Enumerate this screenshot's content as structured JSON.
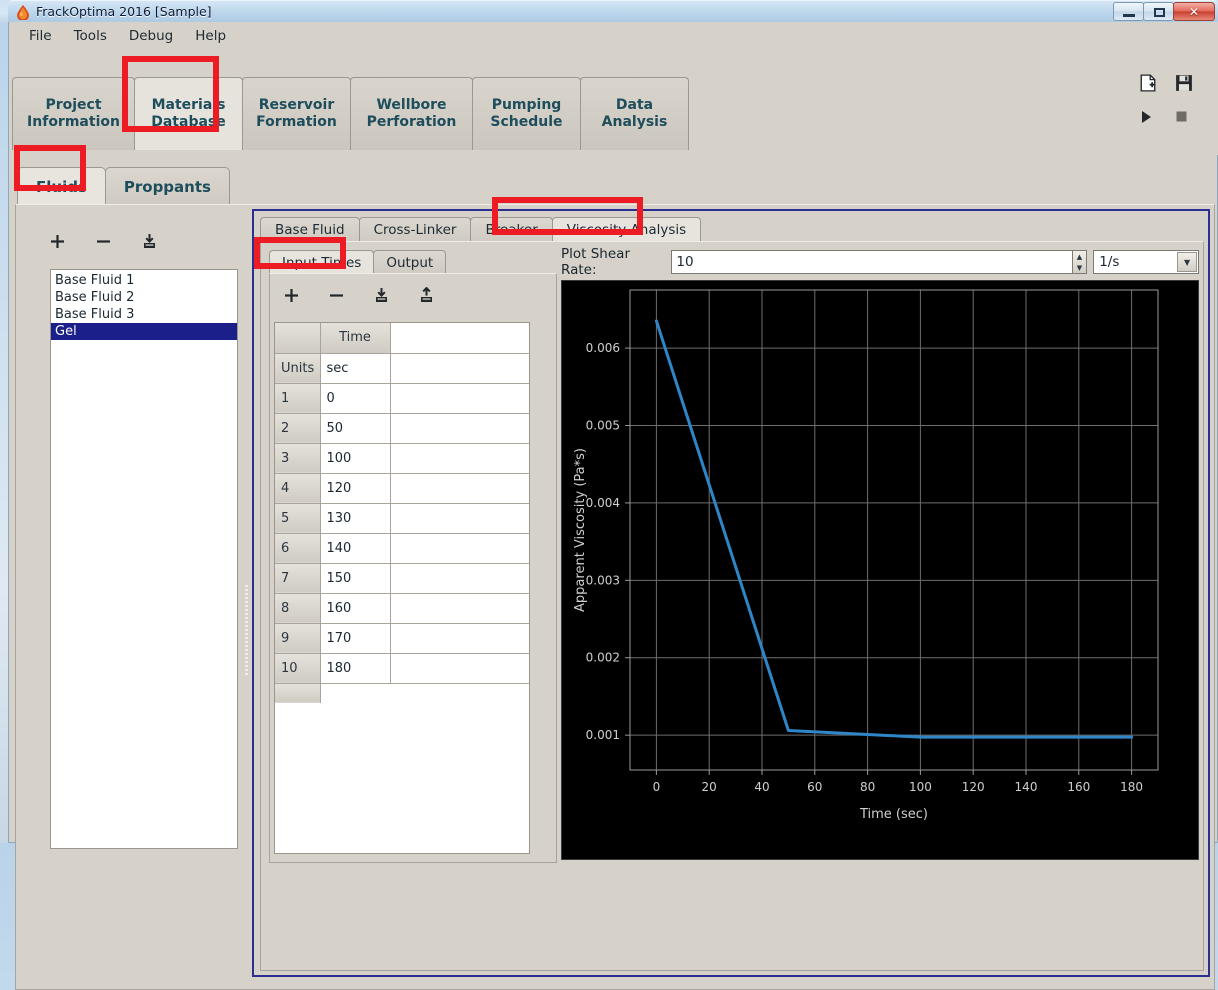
{
  "window": {
    "title": "FrackOptima 2016 [Sample]",
    "app_icon": "oil-drop-icon",
    "minimize": "–",
    "maximize": "□",
    "close": "✕"
  },
  "menu": {
    "items": [
      {
        "label": "File"
      },
      {
        "label": "Tools"
      },
      {
        "label": "Debug"
      },
      {
        "label": "Help"
      }
    ]
  },
  "ribbon": {
    "tabs": [
      {
        "line1": "Project",
        "line2": "Information",
        "active": false
      },
      {
        "line1": "Materials",
        "line2": "Database",
        "active": true
      },
      {
        "line1": "Reservoir",
        "line2": "Formation",
        "active": false
      },
      {
        "line1": "Wellbore",
        "line2": "Perforation",
        "active": false
      },
      {
        "line1": "Pumping",
        "line2": "Schedule",
        "active": false
      },
      {
        "line1": "Data",
        "line2": "Analysis",
        "active": false
      }
    ],
    "icons": [
      {
        "name": "new-file-icon"
      },
      {
        "name": "save-icon"
      },
      {
        "name": "run-icon"
      },
      {
        "name": "stop-icon"
      }
    ]
  },
  "material_tabs": [
    {
      "label": "Fluids",
      "active": true
    },
    {
      "label": "Proppants",
      "active": false
    }
  ],
  "fluid_panel": {
    "tools": [
      {
        "name": "add-fluid-button",
        "glyph": "plus"
      },
      {
        "name": "remove-fluid-button",
        "glyph": "minus"
      },
      {
        "name": "import-fluid-button",
        "glyph": "import"
      }
    ],
    "items": [
      {
        "label": "Base Fluid 1",
        "selected": false
      },
      {
        "label": "Base Fluid 2",
        "selected": false
      },
      {
        "label": "Base Fluid 3",
        "selected": false
      },
      {
        "label": "Gel",
        "selected": true
      }
    ]
  },
  "inner_tabs": [
    {
      "label": "Base Fluid",
      "active": false
    },
    {
      "label": "Cross-Linker",
      "active": false
    },
    {
      "label": "Breaker",
      "active": false
    },
    {
      "label": "Viscosity Analysis",
      "active": true
    }
  ],
  "sub_tabs": [
    {
      "label": "Input Times",
      "active": true
    },
    {
      "label": "Output",
      "active": false
    }
  ],
  "table_tools": [
    {
      "name": "add-row-button",
      "glyph": "plus"
    },
    {
      "name": "remove-row-button",
      "glyph": "minus"
    },
    {
      "name": "import-table-button",
      "glyph": "import"
    },
    {
      "name": "export-table-button",
      "glyph": "export"
    }
  ],
  "input_table": {
    "corner_header": "",
    "columns": [
      "Time"
    ],
    "units_row_label": "Units",
    "units": [
      "sec"
    ],
    "rows": [
      {
        "index": "1",
        "values": [
          "0"
        ]
      },
      {
        "index": "2",
        "values": [
          "50"
        ]
      },
      {
        "index": "3",
        "values": [
          "100"
        ]
      },
      {
        "index": "4",
        "values": [
          "120"
        ]
      },
      {
        "index": "5",
        "values": [
          "130"
        ]
      },
      {
        "index": "6",
        "values": [
          "140"
        ]
      },
      {
        "index": "7",
        "values": [
          "150"
        ]
      },
      {
        "index": "8",
        "values": [
          "160"
        ]
      },
      {
        "index": "9",
        "values": [
          "170"
        ]
      },
      {
        "index": "10",
        "values": [
          "180"
        ]
      }
    ]
  },
  "plot_controls": {
    "label": "Plot Shear Rate:",
    "value": "10",
    "placeholder": "",
    "unit": "1/s",
    "unit_options": [
      "1/s"
    ],
    "spinner_up": "▲",
    "spinner_down": "▼",
    "dropdown_arrow": "▼"
  },
  "highlights": [
    {
      "name": "highlight-materials-database"
    },
    {
      "name": "highlight-fluids-tab"
    },
    {
      "name": "highlight-viscosity-analysis-tab"
    },
    {
      "name": "highlight-input-times-tab"
    }
  ],
  "chart_data": {
    "type": "line",
    "title": "",
    "xlabel": "Time (sec)",
    "ylabel": "Apparent Viscosity (Pa*s)",
    "xlim": [
      -10,
      190
    ],
    "ylim": [
      0.00055,
      0.00675
    ],
    "xticks": [
      0,
      20,
      40,
      60,
      80,
      100,
      120,
      140,
      160,
      180
    ],
    "yticks": [
      0.001,
      0.002,
      0.003,
      0.004,
      0.005,
      0.006
    ],
    "ytick_labels": [
      "0.001",
      "0.002",
      "0.003",
      "0.004",
      "0.005",
      "0.006"
    ],
    "grid": true,
    "background": "#000000",
    "line_color": "#2e86c8",
    "legend": null,
    "series": [
      {
        "name": "Apparent Viscosity",
        "x": [
          0,
          50,
          100,
          120,
          130,
          140,
          150,
          160,
          170,
          180
        ],
        "y": [
          0.00635,
          0.00106,
          0.000975,
          0.000975,
          0.000975,
          0.000975,
          0.000975,
          0.000975,
          0.000975,
          0.000975
        ]
      }
    ]
  }
}
